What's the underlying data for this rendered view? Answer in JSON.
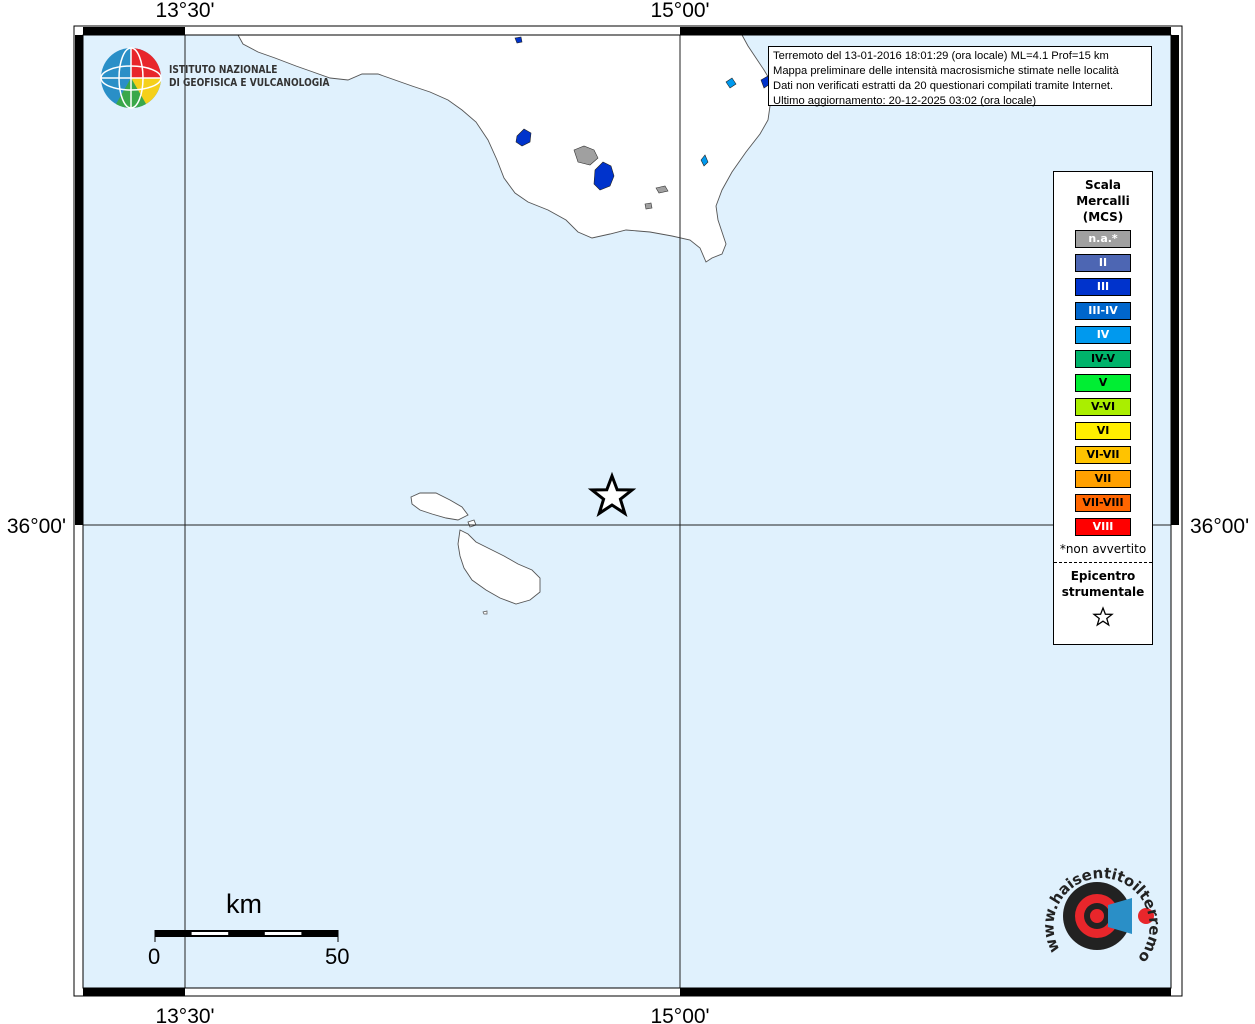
{
  "axes": {
    "lon_labels": [
      "13°30'",
      "15°00'"
    ],
    "lat_labels": [
      "36°00'"
    ]
  },
  "info": {
    "line1": "Terremoto del 13-01-2016 18:01:29 (ora locale) ML=4.1 Prof=15 km",
    "line2": "Mappa preliminare delle intensità macrosismiche stimate nelle località",
    "line3": "Dati non verificati estratti da 20 questionari compilati tramite Internet.",
    "line4": "Ultimo aggiornamento: 20-12-2025 03:02 (ora locale)"
  },
  "institute": {
    "line1": "ISTITUTO NAZIONALE",
    "line2": "DI GEOFISICA E VULCANOLOGIA"
  },
  "legend": {
    "title_lines": [
      "Scala",
      "Mercalli",
      "(MCS)"
    ],
    "items": [
      {
        "label": "n.a.*",
        "color": "#a0a0a0"
      },
      {
        "label": "II",
        "color": "#4d66b3"
      },
      {
        "label": "III",
        "color": "#0033cc"
      },
      {
        "label": "III-IV",
        "color": "#0066cc"
      },
      {
        "label": "IV",
        "color": "#0099ee"
      },
      {
        "label": "IV-V",
        "color": "#00b36b"
      },
      {
        "label": "V",
        "color": "#00ee33"
      },
      {
        "label": "V-VI",
        "color": "#aaee00"
      },
      {
        "label": "VI",
        "color": "#ffee00"
      },
      {
        "label": "VI-VII",
        "color": "#ffc300"
      },
      {
        "label": "VII",
        "color": "#ffa000"
      },
      {
        "label": "VII-VIII",
        "color": "#ff6600"
      },
      {
        "label": "VIII",
        "color": "#ff0000"
      }
    ],
    "note": "*non avvertito",
    "epicenter_lines": [
      "Epicentro",
      "strumentale"
    ]
  },
  "scalebar": {
    "unit": "km",
    "min_label": "0",
    "max_label": "50"
  },
  "watermark": {
    "text": "www.haisentitoilterremoto.it"
  },
  "colors": {
    "sea": "#e0f1fd",
    "land": "#ffffff",
    "intensity_dark_blue": "#0033cc",
    "not_felt_gray": "#a0a0a0"
  }
}
